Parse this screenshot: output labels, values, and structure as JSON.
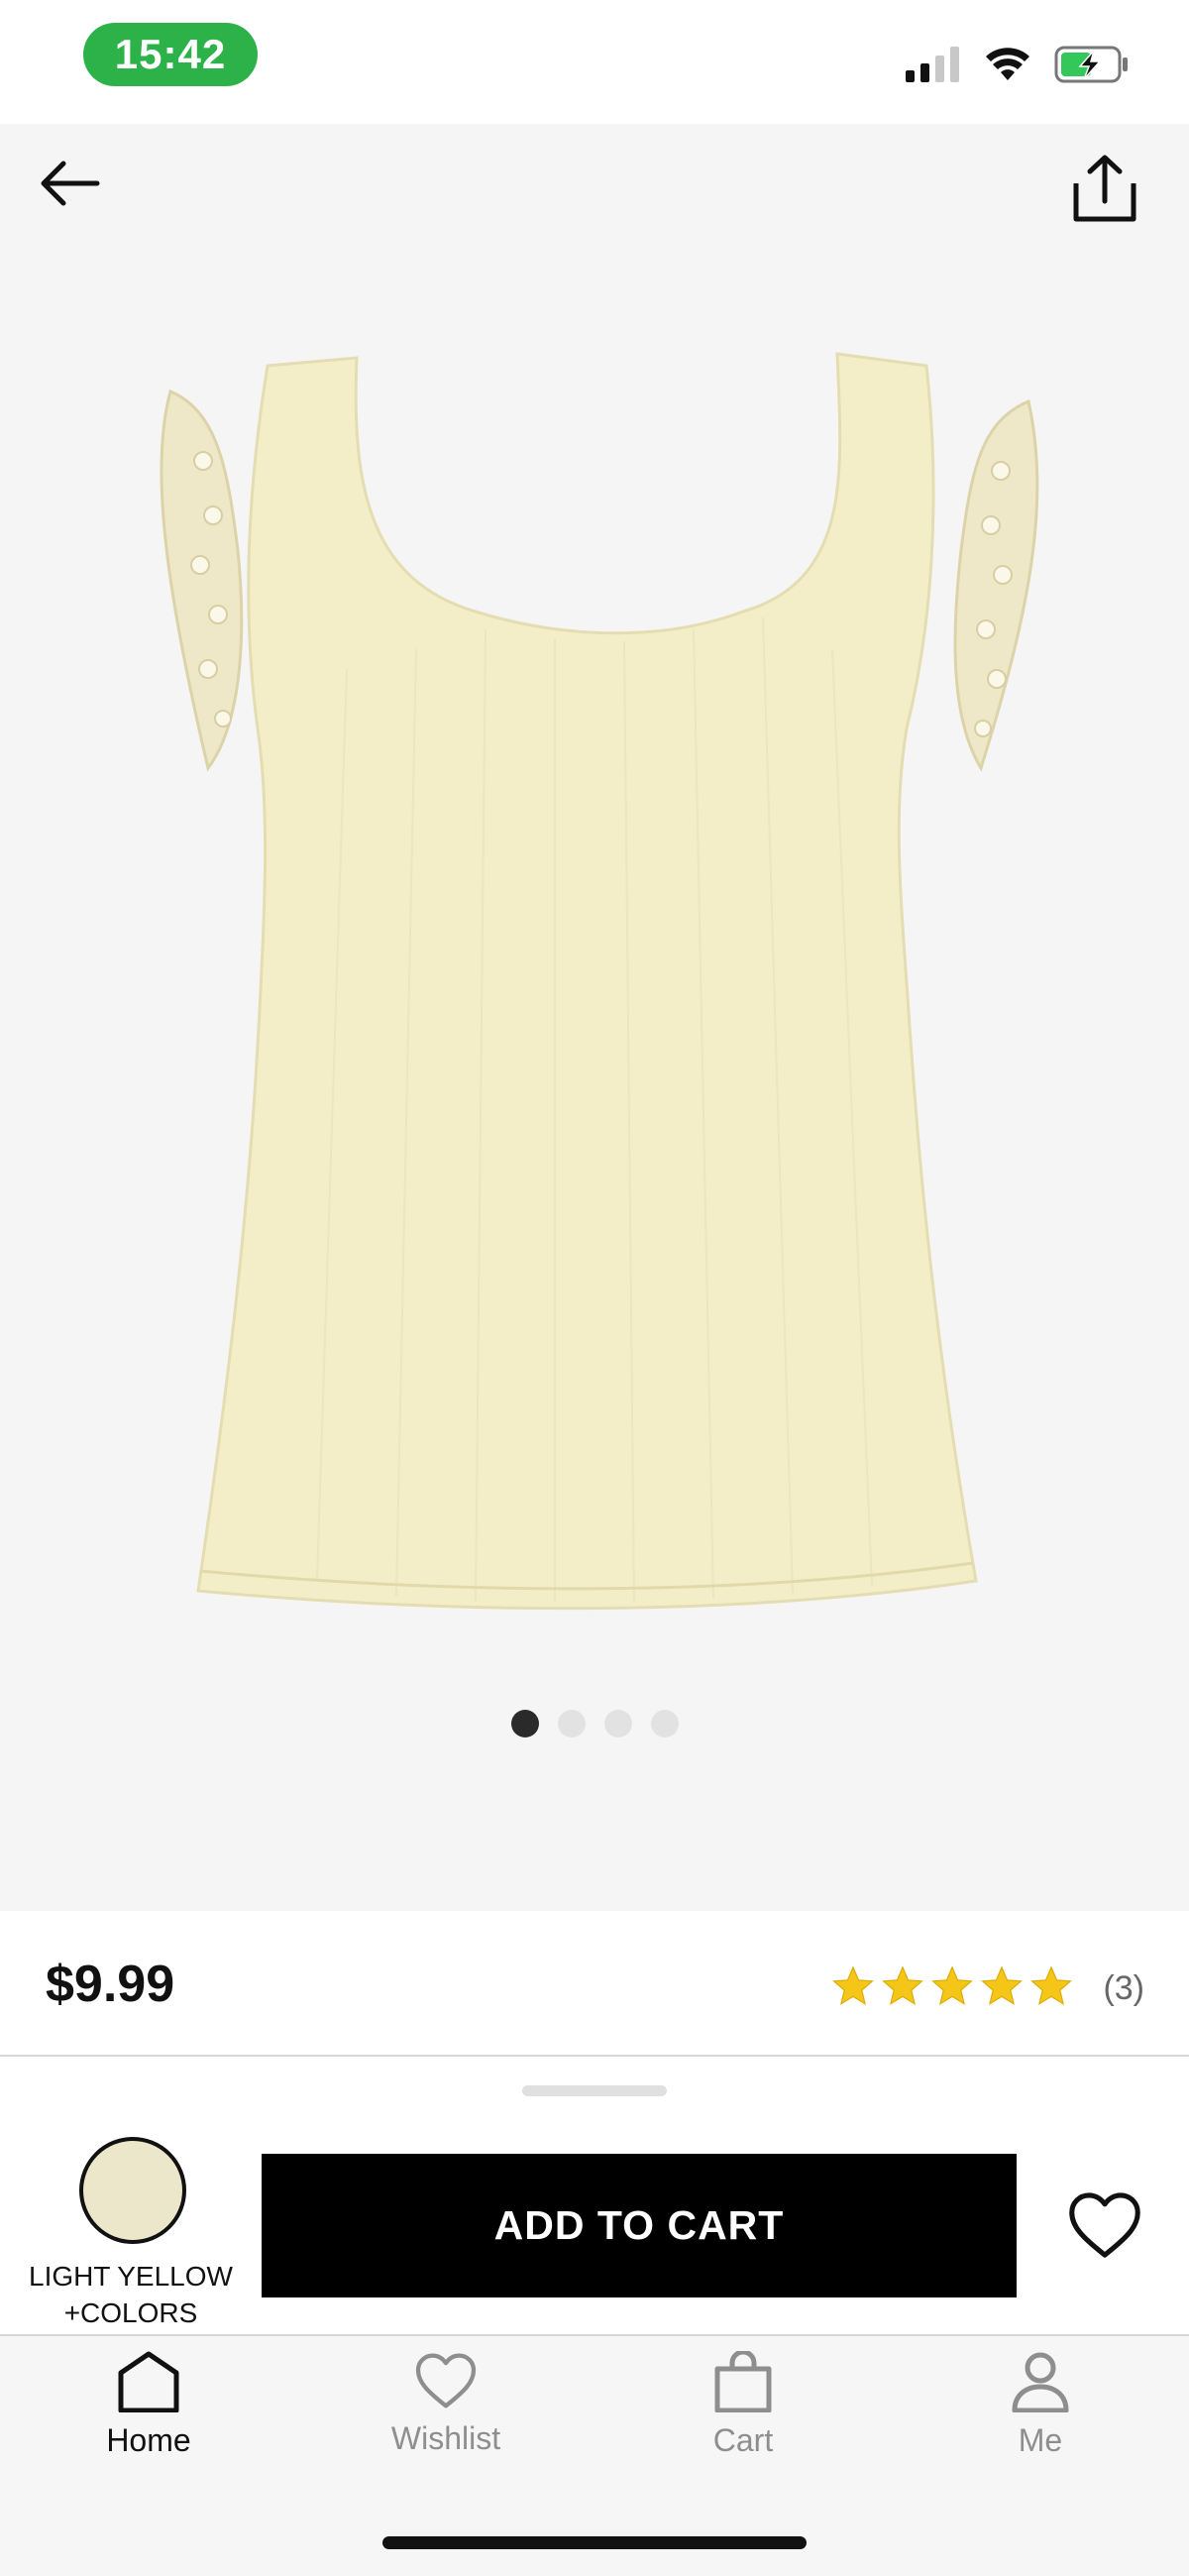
{
  "status_bar": {
    "time": "15:42",
    "signal_bars": 2,
    "battery": "charging"
  },
  "nav": {
    "back_icon": "arrow-left-icon",
    "share_icon": "share-icon"
  },
  "product": {
    "image": "light-yellow-ribbed-tank-top-with-lace-sleeves",
    "image_count": 4,
    "active_image": 1,
    "price": "$9.99",
    "rating": 5,
    "rating_count": "(3)",
    "color_label_line1": "LIGHT YELLOW",
    "color_label_line2": "+COLORS",
    "swatch_color": "#ece6cb"
  },
  "actions": {
    "add_to_cart": "ADD TO CART",
    "wishlist_icon": "heart-icon"
  },
  "tabbar": {
    "items": [
      {
        "label": "Home",
        "icon": "home-icon",
        "active": true
      },
      {
        "label": "Wishlist",
        "icon": "heart-icon",
        "active": false
      },
      {
        "label": "Cart",
        "icon": "bag-icon",
        "active": false
      },
      {
        "label": "Me",
        "icon": "person-icon",
        "active": false
      }
    ]
  },
  "colors": {
    "status_green": "#2db24a",
    "star": "#f5c518",
    "button": "#000000",
    "inactive": "#8e8e8e"
  }
}
